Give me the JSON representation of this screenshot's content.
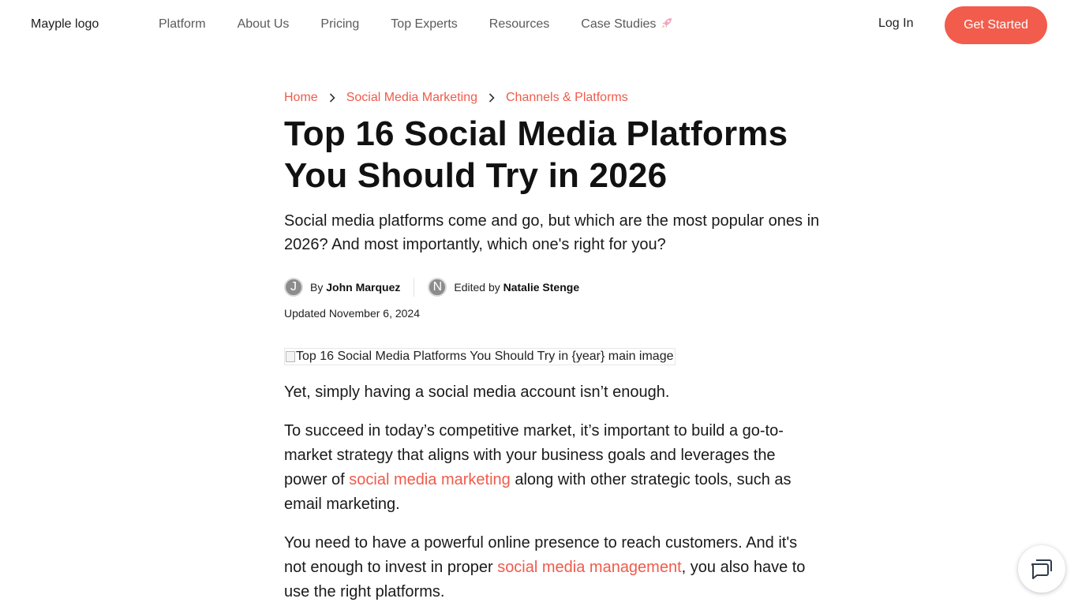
{
  "header": {
    "logo_alt": "Mayple logo",
    "nav": [
      {
        "label": "Platform"
      },
      {
        "label": "About Us"
      },
      {
        "label": "Pricing"
      },
      {
        "label": "Top Experts"
      },
      {
        "label": "Resources"
      },
      {
        "label": "Case Studies"
      }
    ],
    "case_studies_icon": "rocket-icon",
    "login_label": "Log In",
    "cta_label": "Get Started",
    "accent_color": "#f25c4c"
  },
  "breadcrumb": {
    "items": [
      "Home",
      "Social Media Marketing",
      "Channels & Platforms"
    ],
    "separator_icon": "chevron-right-icon"
  },
  "article": {
    "title": "Top 16 Social Media Platforms You Should Try in 2026",
    "lede": "Social media platforms come and go, but which are the most popular ones in 2026? And most importantly, which one's right for you?",
    "author": {
      "initial": "J",
      "prefix": "By",
      "name": "John Marquez"
    },
    "editor": {
      "initial": "N",
      "prefix": "Edited by",
      "name": "Natalie Stenge"
    },
    "updated": "Updated November 6, 2024",
    "main_image_alt": "Top 16 Social Media Platforms You Should Try in {year} main image",
    "paragraphs": {
      "p1": "Yet, simply having a social media account isn’t enough.",
      "p2_before": "To succeed in today’s competitive market, it’s important to build a go-to-market strategy that aligns with your business goals and leverages the power of ",
      "p2_link": "social media marketing",
      "p2_after": " along with other strategic tools, such as email marketing.",
      "p3_before": "You need to have a powerful online presence to reach customers. And it's not enough to invest in proper ",
      "p3_link": "social media management",
      "p3_after": ", you also have to use the right platforms."
    }
  },
  "chat_widget": {
    "icon": "chat-icon"
  }
}
